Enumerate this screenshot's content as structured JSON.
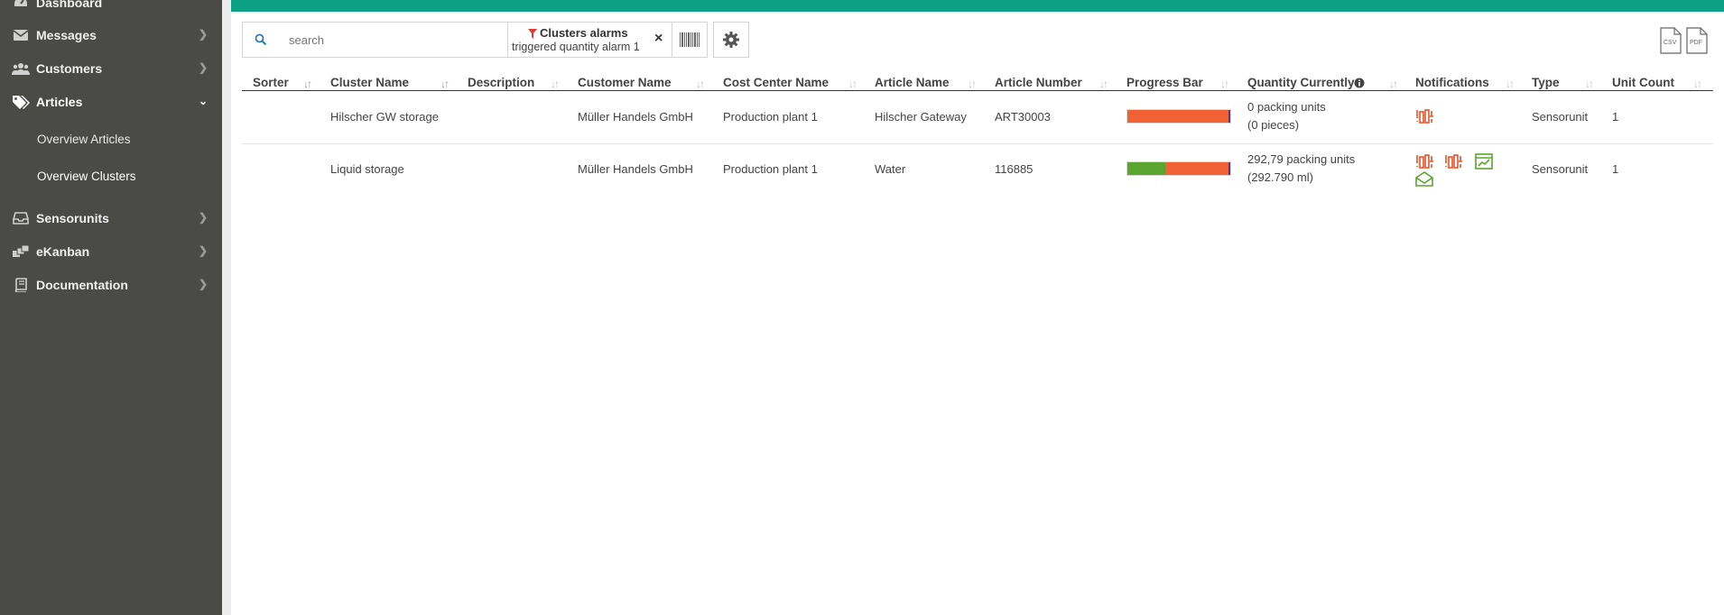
{
  "sidebar": {
    "items": [
      {
        "label": "Dashboard",
        "icon": "dashboard-icon"
      },
      {
        "label": "Messages",
        "icon": "envelope-icon"
      },
      {
        "label": "Customers",
        "icon": "users-icon"
      },
      {
        "label": "Articles",
        "icon": "tags-icon"
      },
      {
        "label": "Sensorunits",
        "icon": "inbox-icon"
      },
      {
        "label": "eKanban",
        "icon": "kanban-icon"
      },
      {
        "label": "Documentation",
        "icon": "book-icon"
      }
    ],
    "subitems": [
      {
        "label": "Overview Articles"
      },
      {
        "label": "Overview Clusters"
      }
    ]
  },
  "toolbar": {
    "search_placeholder": "search",
    "filter_title": "Clusters alarms",
    "filter_value": "triggered quantity alarm 1",
    "remove_filter": "×"
  },
  "export": {
    "csv": "CSV",
    "pdf": "PDF"
  },
  "table": {
    "headers": [
      "Sorter",
      "Cluster Name",
      "Description",
      "Customer Name",
      "Cost Center Name",
      "Article Name",
      "Article Number",
      "Progress Bar",
      "Quantity Currently",
      "Notifications",
      "Type",
      "Unit Count"
    ],
    "rows": [
      {
        "sorter": "",
        "cluster_name": "Hilscher GW storage",
        "description": "",
        "customer_name": "Müller Handels GmbH",
        "cost_center": "Production plant 1",
        "article_name": "Hilscher Gateway",
        "article_number": "ART30003",
        "progress_green": 0,
        "quantity_line1": "0 packing units",
        "quantity_line2": "(0 pieces)",
        "type": "Sensorunit",
        "unit_count": "1"
      },
      {
        "sorter": "",
        "cluster_name": "Liquid storage",
        "description": "",
        "customer_name": "Müller Handels GmbH",
        "cost_center": "Production plant 1",
        "article_name": "Water",
        "article_number": "116885",
        "progress_green": 0.37,
        "quantity_line1": "292,79 packing units",
        "quantity_line2": "(292.790 ml)",
        "type": "Sensorunit",
        "unit_count": "1"
      }
    ]
  },
  "colors": {
    "accent": "#0da085",
    "sidebar": "#4a4a47",
    "alarm": "#e8532b",
    "ok": "#5aa52e",
    "marker": "#3b3fb8",
    "filter": "#e53935"
  }
}
